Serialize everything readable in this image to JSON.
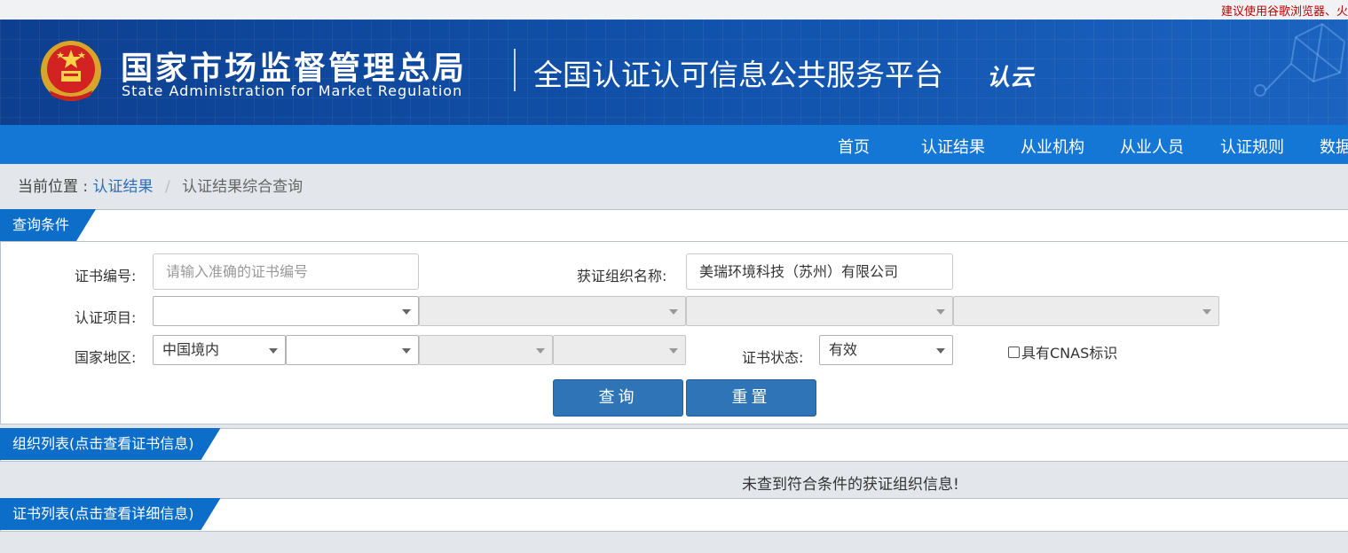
{
  "notice": "建议使用谷歌浏览器、火",
  "header": {
    "cn_name": "国家市场监督管理总局",
    "en_name": "State Administration  for  Market Regulation",
    "platform": "全国认证认可信息公共服务平台",
    "cloud_logo": "认云"
  },
  "nav": {
    "items": [
      "首页",
      "认证结果",
      "从业机构",
      "从业人员",
      "认证规则",
      "数据"
    ]
  },
  "breadcrumb": {
    "prefix": "当前位置 :",
    "link": "认证结果",
    "separator": "/",
    "current": "认证结果综合查询"
  },
  "query": {
    "title": "查询条件",
    "cert_no_label": "证书编号:",
    "cert_no_placeholder": "请输入准确的证书编号",
    "org_name_label": "获证组织名称:",
    "org_name_value": "美瑞环境科技（苏州）有限公司",
    "project_label": "认证项目:",
    "region_label": "国家地区:",
    "region_value": "中国境内",
    "status_label": "证书状态:",
    "status_value": "有效",
    "cnas_label": "具有CNAS标识",
    "search_button": "查询",
    "reset_button": "重置"
  },
  "org_list": {
    "title": "组织列表(点击查看证书信息)",
    "empty_message": "未查到符合条件的获证组织信息!"
  },
  "cert_list": {
    "title": "证书列表(点击查看详细信息)"
  }
}
